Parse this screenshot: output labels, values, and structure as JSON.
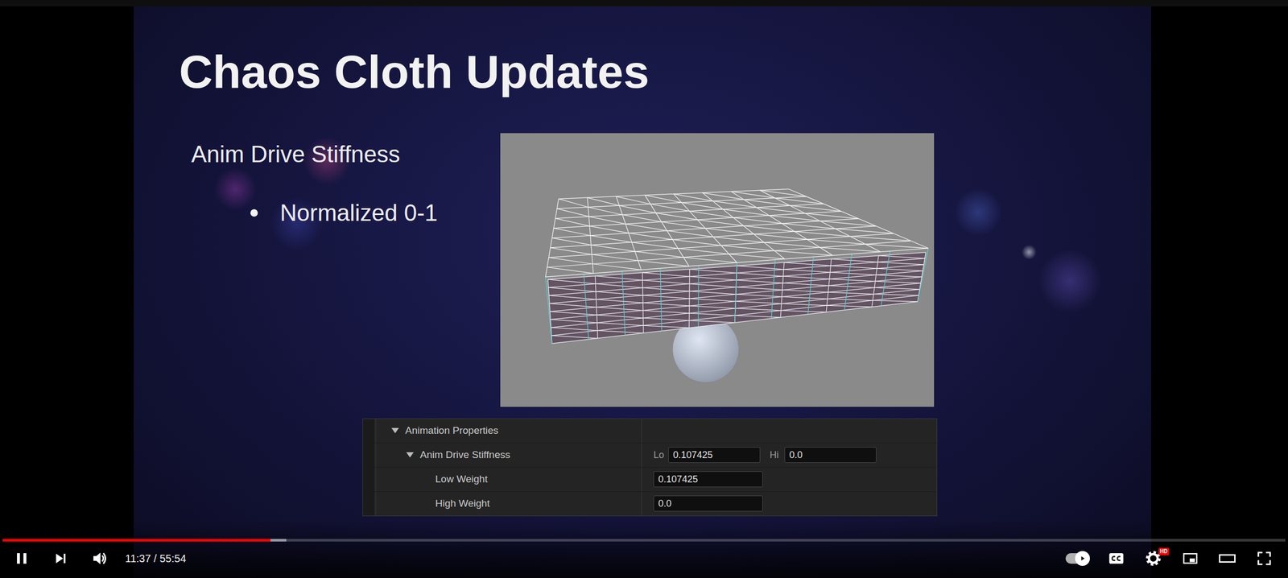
{
  "slide": {
    "title": "Chaos Cloth Updates",
    "heading": "Anim Drive Stiffness",
    "bullets": [
      "Normalized 0-1"
    ],
    "panel": {
      "section": {
        "label": "Animation Properties",
        "expanded": true
      },
      "group": {
        "label": "Anim Drive Stiffness",
        "expanded": true,
        "fields": [
          {
            "label": "Lo",
            "value": "0.107425"
          },
          {
            "label": "Hi",
            "value": "0.0"
          }
        ]
      },
      "rows": [
        {
          "label": "Low Weight",
          "value": "0.107425"
        },
        {
          "label": "High Weight",
          "value": "0.0"
        }
      ]
    }
  },
  "player": {
    "playing": true,
    "progress": 0.209,
    "buffered": 0.221,
    "time": "11:37 / 55:54",
    "autoplay": true,
    "captions": false,
    "quality_badge": "HD"
  }
}
